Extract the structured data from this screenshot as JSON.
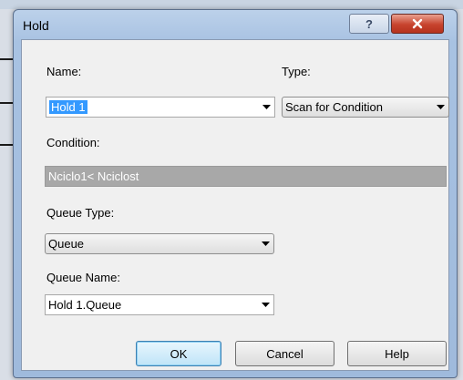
{
  "dialog": {
    "title": "Hold",
    "help_glyph": "?",
    "close_glyph": "x",
    "fields": {
      "name": {
        "label": "Name:",
        "value": "Hold 1"
      },
      "type": {
        "label": "Type:",
        "value": "Scan for Condition"
      },
      "condition": {
        "label": "Condition:",
        "value": "Nciclo1< Nciclost"
      },
      "queue_type": {
        "label": "Queue Type:",
        "value": "Queue"
      },
      "queue_name": {
        "label": "Queue Name:",
        "value": "Hold 1.Queue"
      }
    },
    "buttons": {
      "ok": "OK",
      "cancel": "Cancel",
      "help": "Help"
    }
  },
  "icons": {
    "help": "question-mark-icon",
    "close": "close-x-icon",
    "dropdown": "chevron-down-icon"
  },
  "colors": {
    "selection": "#3399ff",
    "close_button": "#c7432e",
    "disabled_field": "#a8a8a8"
  }
}
